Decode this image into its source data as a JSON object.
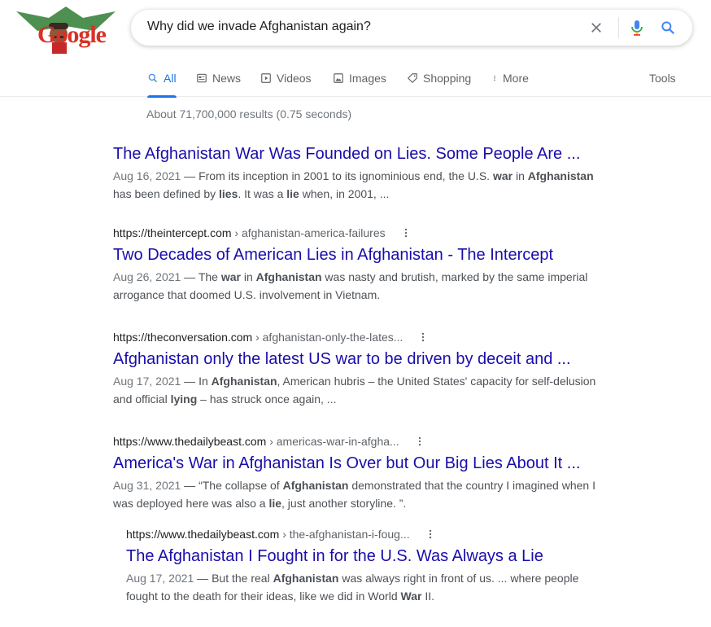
{
  "logo": {
    "text": "Google"
  },
  "search": {
    "query": "Why did we invade Afghanistan again?"
  },
  "tabs": [
    {
      "label": "All",
      "icon": "search-icon",
      "active": true
    },
    {
      "label": "News",
      "icon": "news-icon"
    },
    {
      "label": "Videos",
      "icon": "video-icon"
    },
    {
      "label": "Images",
      "icon": "image-icon"
    },
    {
      "label": "Shopping",
      "icon": "tag-icon"
    },
    {
      "label": "More",
      "icon": "more-vert-icon"
    },
    {
      "label": "Tools"
    }
  ],
  "stats": "About 71,700,000 results (0.75 seconds)",
  "results": [
    {
      "cite": "",
      "path": "",
      "title": "The Afghanistan War Was Founded on Lies. Some People Are ...",
      "date": "Aug 16, 2021",
      "snippet_parts": [
        {
          "t": " — From its inception in 2001 to its ignominious end, the U.S. "
        },
        {
          "t": "war",
          "b": true
        },
        {
          "t": " in "
        },
        {
          "t": "Afghanistan",
          "b": true
        },
        {
          "t": " has been defined by "
        },
        {
          "t": "lies",
          "b": true
        },
        {
          "t": ". It was a "
        },
        {
          "t": "lie",
          "b": true
        },
        {
          "t": " when, in 2001, ..."
        }
      ]
    },
    {
      "cite": "https://theintercept.com",
      "path": " › afghanistan-america-failures",
      "title": "Two Decades of American Lies in Afghanistan - The Intercept",
      "date": "Aug 26, 2021",
      "snippet_parts": [
        {
          "t": " — The "
        },
        {
          "t": "war",
          "b": true
        },
        {
          "t": " in "
        },
        {
          "t": "Afghanistan",
          "b": true
        },
        {
          "t": " was nasty and brutish, marked by the same imperial arrogance that doomed U.S. involvement in Vietnam."
        }
      ]
    },
    {
      "cite": "https://theconversation.com",
      "path": " › afghanistan-only-the-lates...",
      "title": "Afghanistan only the latest US war to be driven by deceit and ...",
      "date": "Aug 17, 2021",
      "snippet_parts": [
        {
          "t": " — In "
        },
        {
          "t": "Afghanistan",
          "b": true
        },
        {
          "t": ", American hubris – the United States' capacity for self-delusion and official "
        },
        {
          "t": "lying",
          "b": true
        },
        {
          "t": " – has struck once again, ..."
        }
      ]
    },
    {
      "cite": "https://www.thedailybeast.com",
      "path": " › americas-war-in-afgha...",
      "title": "America's War in Afghanistan Is Over but Our Big Lies About It ...",
      "date": "Aug 31, 2021",
      "snippet_parts": [
        {
          "t": " — “The collapse of "
        },
        {
          "t": "Afghanistan",
          "b": true
        },
        {
          "t": " demonstrated that the country I imagined when I was deployed here was also a "
        },
        {
          "t": "lie",
          "b": true
        },
        {
          "t": ", just another storyline. ”."
        }
      ]
    },
    {
      "cite": "https://www.thedailybeast.com",
      "path": " › the-afghanistan-i-foug...",
      "title": "The Afghanistan I Fought in for the U.S. Was Always a Lie",
      "date": "Aug 17, 2021",
      "snippet_parts": [
        {
          "t": " — But the real "
        },
        {
          "t": "Afghanistan",
          "b": true
        },
        {
          "t": " was always right in front of us. ... where people fought to the death for their ideas, like we did in World "
        },
        {
          "t": "War",
          "b": true
        },
        {
          "t": " II."
        }
      ]
    }
  ]
}
